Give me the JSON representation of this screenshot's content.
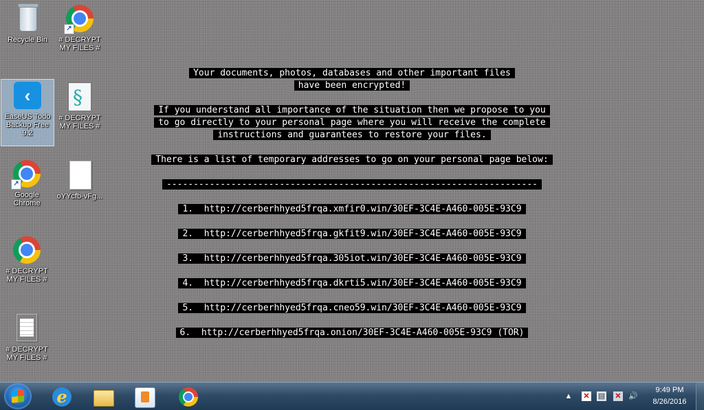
{
  "desktop_icons": [
    {
      "label": "Recycle Bin",
      "icon": "recycle-bin-icon"
    },
    {
      "label": "# DECRYPT\nMY FILES #",
      "icon": "chrome-icon"
    },
    {
      "label": "EaseUS Todo\nBackup Free\n9.2",
      "icon": "easeus-icon"
    },
    {
      "label": "# DECRYPT\nMY FILES #",
      "icon": "script-file-icon"
    },
    {
      "label": "Google\nChrome",
      "icon": "chrome-icon"
    },
    {
      "label": "oYYcfb-vFg...",
      "icon": "blank-file-icon"
    },
    {
      "label": "# DECRYPT\nMY FILES #",
      "icon": "chrome-icon"
    },
    {
      "label": "# DECRYPT\nMY FILES #",
      "icon": "text-file-icon"
    }
  ],
  "note": {
    "line1": "Your documents, photos, databases and other important files",
    "line2": "have been encrypted!",
    "line3": "If you understand all importance of the situation then we propose to you",
    "line4": "to go directly to your personal page where you will receive the complete",
    "line5": "instructions and guarantees to restore your files.",
    "line6": "There is a list of temporary addresses to go on your personal page below:",
    "separator": "---------------------------------------------------------------------",
    "addresses": [
      "1.  http://cerberhhyed5frqa.xmfir0.win/30EF-3C4E-A460-005E-93C9",
      "2.  http://cerberhhyed5frqa.gkfit9.win/30EF-3C4E-A460-005E-93C9",
      "3.  http://cerberhhyed5frqa.305iot.win/30EF-3C4E-A460-005E-93C9",
      "4.  http://cerberhhyed5frqa.dkrti5.win/30EF-3C4E-A460-005E-93C9",
      "5.  http://cerberhhyed5frqa.cneo59.win/30EF-3C4E-A460-005E-93C9",
      "6.  http://cerberhhyed5frqa.onion/30EF-3C4E-A460-005E-93C9 (TOR)"
    ]
  },
  "taskbar": {
    "pinned": [
      "windows-start-icon",
      "internet-explorer-icon",
      "file-explorer-icon",
      "media-player-icon",
      "chrome-icon"
    ],
    "tray": {
      "overflow": "▲",
      "time": "9:49 PM",
      "date": "8/26/2016"
    }
  }
}
